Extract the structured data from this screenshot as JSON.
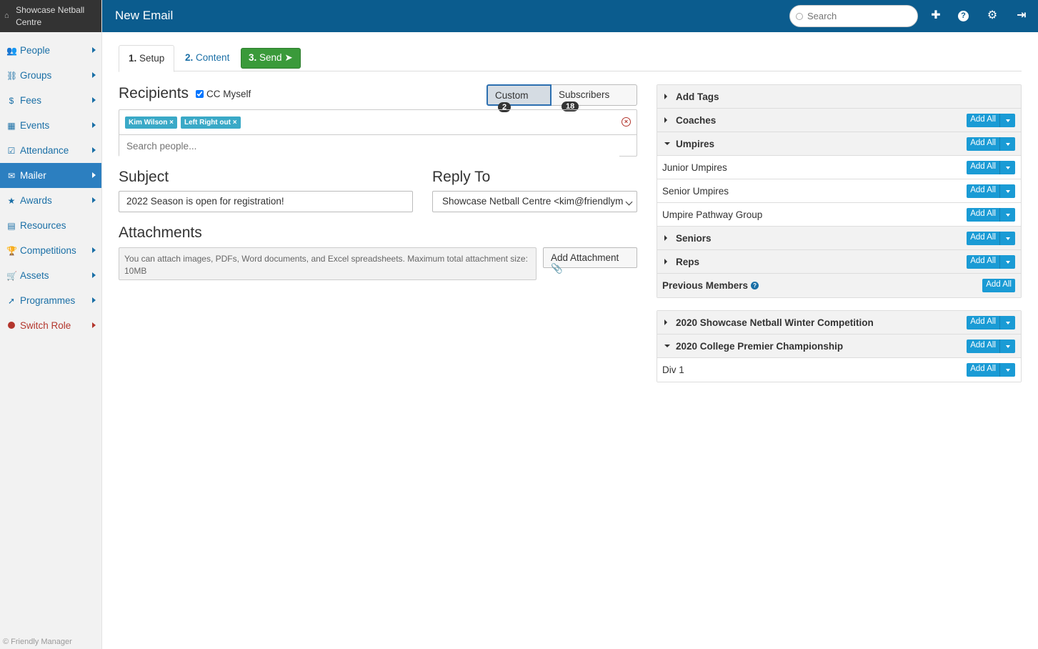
{
  "app": {
    "brand": "Showcase Netball Centre",
    "footer": "© Friendly Manager"
  },
  "sidebar": {
    "items": [
      {
        "label": "People",
        "icon": "people-icon"
      },
      {
        "label": "Groups",
        "icon": "groups-icon"
      },
      {
        "label": "Fees",
        "icon": "dollar-icon"
      },
      {
        "label": "Events",
        "icon": "calendar-icon"
      },
      {
        "label": "Attendance",
        "icon": "check-square-icon"
      },
      {
        "label": "Mailer",
        "icon": "envelope-icon"
      },
      {
        "label": "Awards",
        "icon": "star-icon"
      },
      {
        "label": "Resources",
        "icon": "film-icon"
      },
      {
        "label": "Competitions",
        "icon": "trophy-icon"
      },
      {
        "label": "Assets",
        "icon": "cart-icon"
      },
      {
        "label": "Programmes",
        "icon": "rocket-icon"
      },
      {
        "label": "Switch Role",
        "icon": "circle-icon"
      }
    ],
    "active": "Mailer"
  },
  "topbar": {
    "title": "New Email",
    "search_placeholder": "Search"
  },
  "tabs": [
    {
      "num": "1.",
      "label": "Setup"
    },
    {
      "num": "2.",
      "label": "Content"
    },
    {
      "num": "3.",
      "label": "Send"
    }
  ],
  "recipients": {
    "heading": "Recipients",
    "cc_label": "CC Myself",
    "cc_checked": true,
    "custom_label": "Custom",
    "custom_count": "2",
    "subscribers_label": "Subscribers",
    "subscribers_count": "18",
    "tags": [
      "Kim Wilson ×",
      "Left Right out ×"
    ],
    "search_placeholder": "Search people..."
  },
  "subject": {
    "heading": "Subject",
    "value": "2022 Season is open for registration!"
  },
  "reply_to": {
    "heading": "Reply To",
    "value": "Showcase Netball Centre <kim@friendlym"
  },
  "attachments": {
    "heading": "Attachments",
    "note": "You can attach images, PDFs, Word documents, and Excel spreadsheets. Maximum total attachment size: 10MB",
    "button": "Add Attachment"
  },
  "panel1": {
    "add_all": "Add All",
    "rows": [
      {
        "label": "Add Tags",
        "type": "group",
        "open": false,
        "button": false
      },
      {
        "label": "Coaches",
        "type": "group",
        "open": false,
        "button": true
      },
      {
        "label": "Umpires",
        "type": "group",
        "open": true,
        "button": true
      },
      {
        "label": "Junior Umpires",
        "type": "item",
        "button": true
      },
      {
        "label": "Senior Umpires",
        "type": "item",
        "button": true
      },
      {
        "label": "Umpire Pathway Group",
        "type": "item",
        "button": true
      },
      {
        "label": "Seniors",
        "type": "group",
        "open": false,
        "button": true
      },
      {
        "label": "Reps",
        "type": "group",
        "open": false,
        "button": true
      },
      {
        "label": "Previous Members",
        "type": "group-flat",
        "button": true
      }
    ]
  },
  "panel2": {
    "rows": [
      {
        "label": "2020 Showcase Netball Winter Competition",
        "type": "group",
        "open": false
      },
      {
        "label": "2020 College Premier Championship",
        "type": "group",
        "open": true
      },
      {
        "label": "Div 1",
        "type": "item"
      }
    ]
  }
}
